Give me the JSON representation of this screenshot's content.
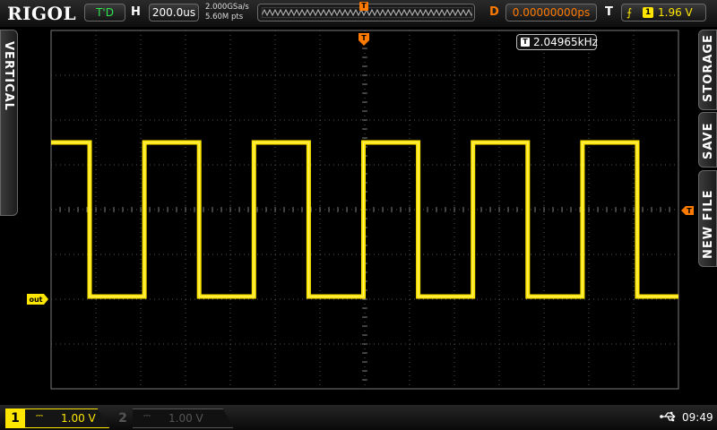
{
  "brand": "RIGOL",
  "status": "T'D",
  "timebase": {
    "label": "H",
    "value": "200.0us"
  },
  "acquisition": {
    "sample_rate": "2.000GSa/s",
    "memory_depth": "5.60M pts"
  },
  "trigger_marker": "T",
  "delay": {
    "label": "D",
    "value": "0.00000000ps"
  },
  "trigger": {
    "label": "T",
    "channel": "1",
    "level": "1.96 V"
  },
  "side_tabs": {
    "left": "VERTICAL",
    "right": [
      "STORAGE",
      "SAVE",
      "NEW FILE"
    ]
  },
  "measurement": {
    "frequency": "2.04965kHz"
  },
  "ch1_marker": "out",
  "channels": [
    {
      "number": "1",
      "scale": "1.00 V",
      "color": "#ffe600",
      "active": true
    },
    {
      "number": "2",
      "scale": "1.00 V",
      "color": "#555555",
      "active": false
    }
  ],
  "clock": "09:49",
  "colors": {
    "trace": "#ffe600",
    "trigger": "#ff7a00",
    "status": "#2ee44f"
  },
  "icons": {
    "usb": "usb-icon",
    "edge": "rising-edge-icon"
  }
}
